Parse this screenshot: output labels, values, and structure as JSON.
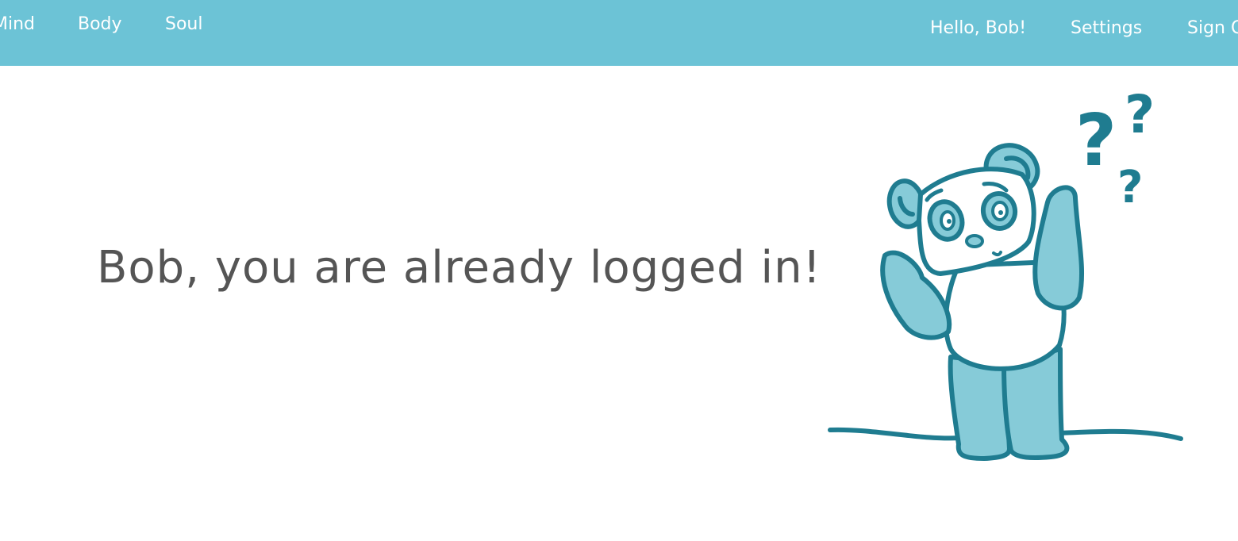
{
  "nav": {
    "left": [
      {
        "label": "Mind"
      },
      {
        "label": "Body"
      },
      {
        "label": "Soul"
      }
    ],
    "right": [
      {
        "label": "Hello, Bob!"
      },
      {
        "label": "Settings"
      },
      {
        "label": "Sign Out"
      }
    ]
  },
  "main": {
    "message": "Bob, you are already logged in!",
    "illustration": {
      "icon": "confused-panda",
      "marks": [
        "?",
        "?",
        "?"
      ]
    }
  },
  "colors": {
    "nav_bg": "#6cc3d6",
    "nav_text": "#ffffff",
    "heading_text": "#555555",
    "panda_outline": "#1f7c90",
    "panda_fill": "#86cbd8"
  }
}
